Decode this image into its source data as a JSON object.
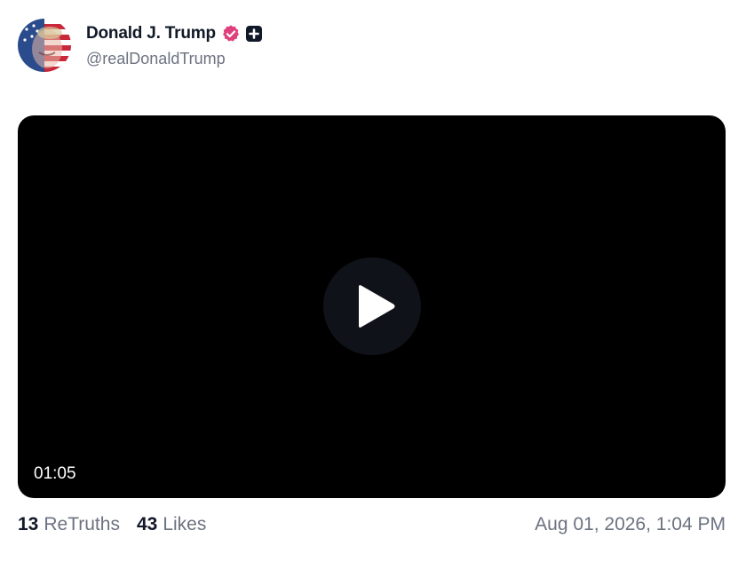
{
  "author": {
    "display_name": "Donald J. Trump",
    "handle": "@realDonaldTrump",
    "verified_icon": "verified-badge-icon",
    "plus_icon": "plus-square-icon",
    "badge_color": "#e1407e"
  },
  "media": {
    "type": "video",
    "duration": "01:05",
    "play_icon": "play-icon"
  },
  "stats": {
    "retruths_count": "13",
    "retruths_label": "ReTruths",
    "likes_count": "43",
    "likes_label": "Likes"
  },
  "timestamp": "Aug 01, 2026, 1:04 PM"
}
